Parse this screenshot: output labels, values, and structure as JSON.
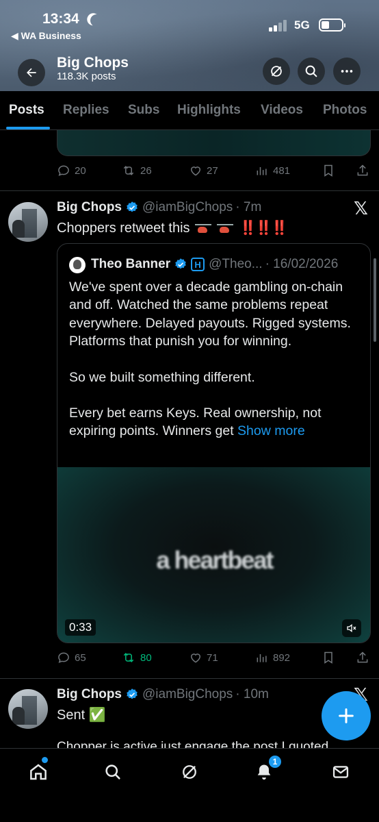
{
  "status": {
    "time": "13:34",
    "back_app": "◀ WA Business",
    "network": "5G"
  },
  "header": {
    "title": "Big Chops",
    "subtitle": "118.3K posts"
  },
  "tabs": [
    {
      "label": "Posts"
    },
    {
      "label": "Replies"
    },
    {
      "label": "Subs"
    },
    {
      "label": "Highlights"
    },
    {
      "label": "Videos"
    },
    {
      "label": "Photos"
    }
  ],
  "prev_post": {
    "replies": "20",
    "reposts": "26",
    "likes": "27",
    "views": "481"
  },
  "post1": {
    "author": "Big Chops",
    "handle": "@iamBigChops",
    "time": "· 7m",
    "text": "Choppers retweet this",
    "emphasis": "‼️‼️‼️",
    "quote": {
      "author": "Theo Banner",
      "badge": "H",
      "handle": "@Theo...",
      "date": "· 16/02/2026",
      "para1": "We've spent over a decade gambling on-chain and off. Watched the same problems repeat everywhere. Delayed payouts. Rigged systems. Platforms that punish you for winning.",
      "para2": "So we built something different.",
      "para3": "Every bet earns Keys. Real ownership, not expiring points. Winners get",
      "show_more": "Show more",
      "video_caption": "a heartbeat",
      "video_time": "0:33"
    },
    "stats": {
      "replies": "65",
      "reposts": "80",
      "likes": "71",
      "views": "892"
    }
  },
  "post2": {
    "author": "Big Chops",
    "handle": "@iamBigChops",
    "time": "· 10m",
    "text": "Sent ✅",
    "clipped_text": "Chopper is active just engage the post I quoted"
  },
  "nav": {
    "notifications_count": "1"
  },
  "colors": {
    "accent": "#1d9bf0",
    "repost_active": "#00ba7c",
    "muted": "#71767b"
  }
}
